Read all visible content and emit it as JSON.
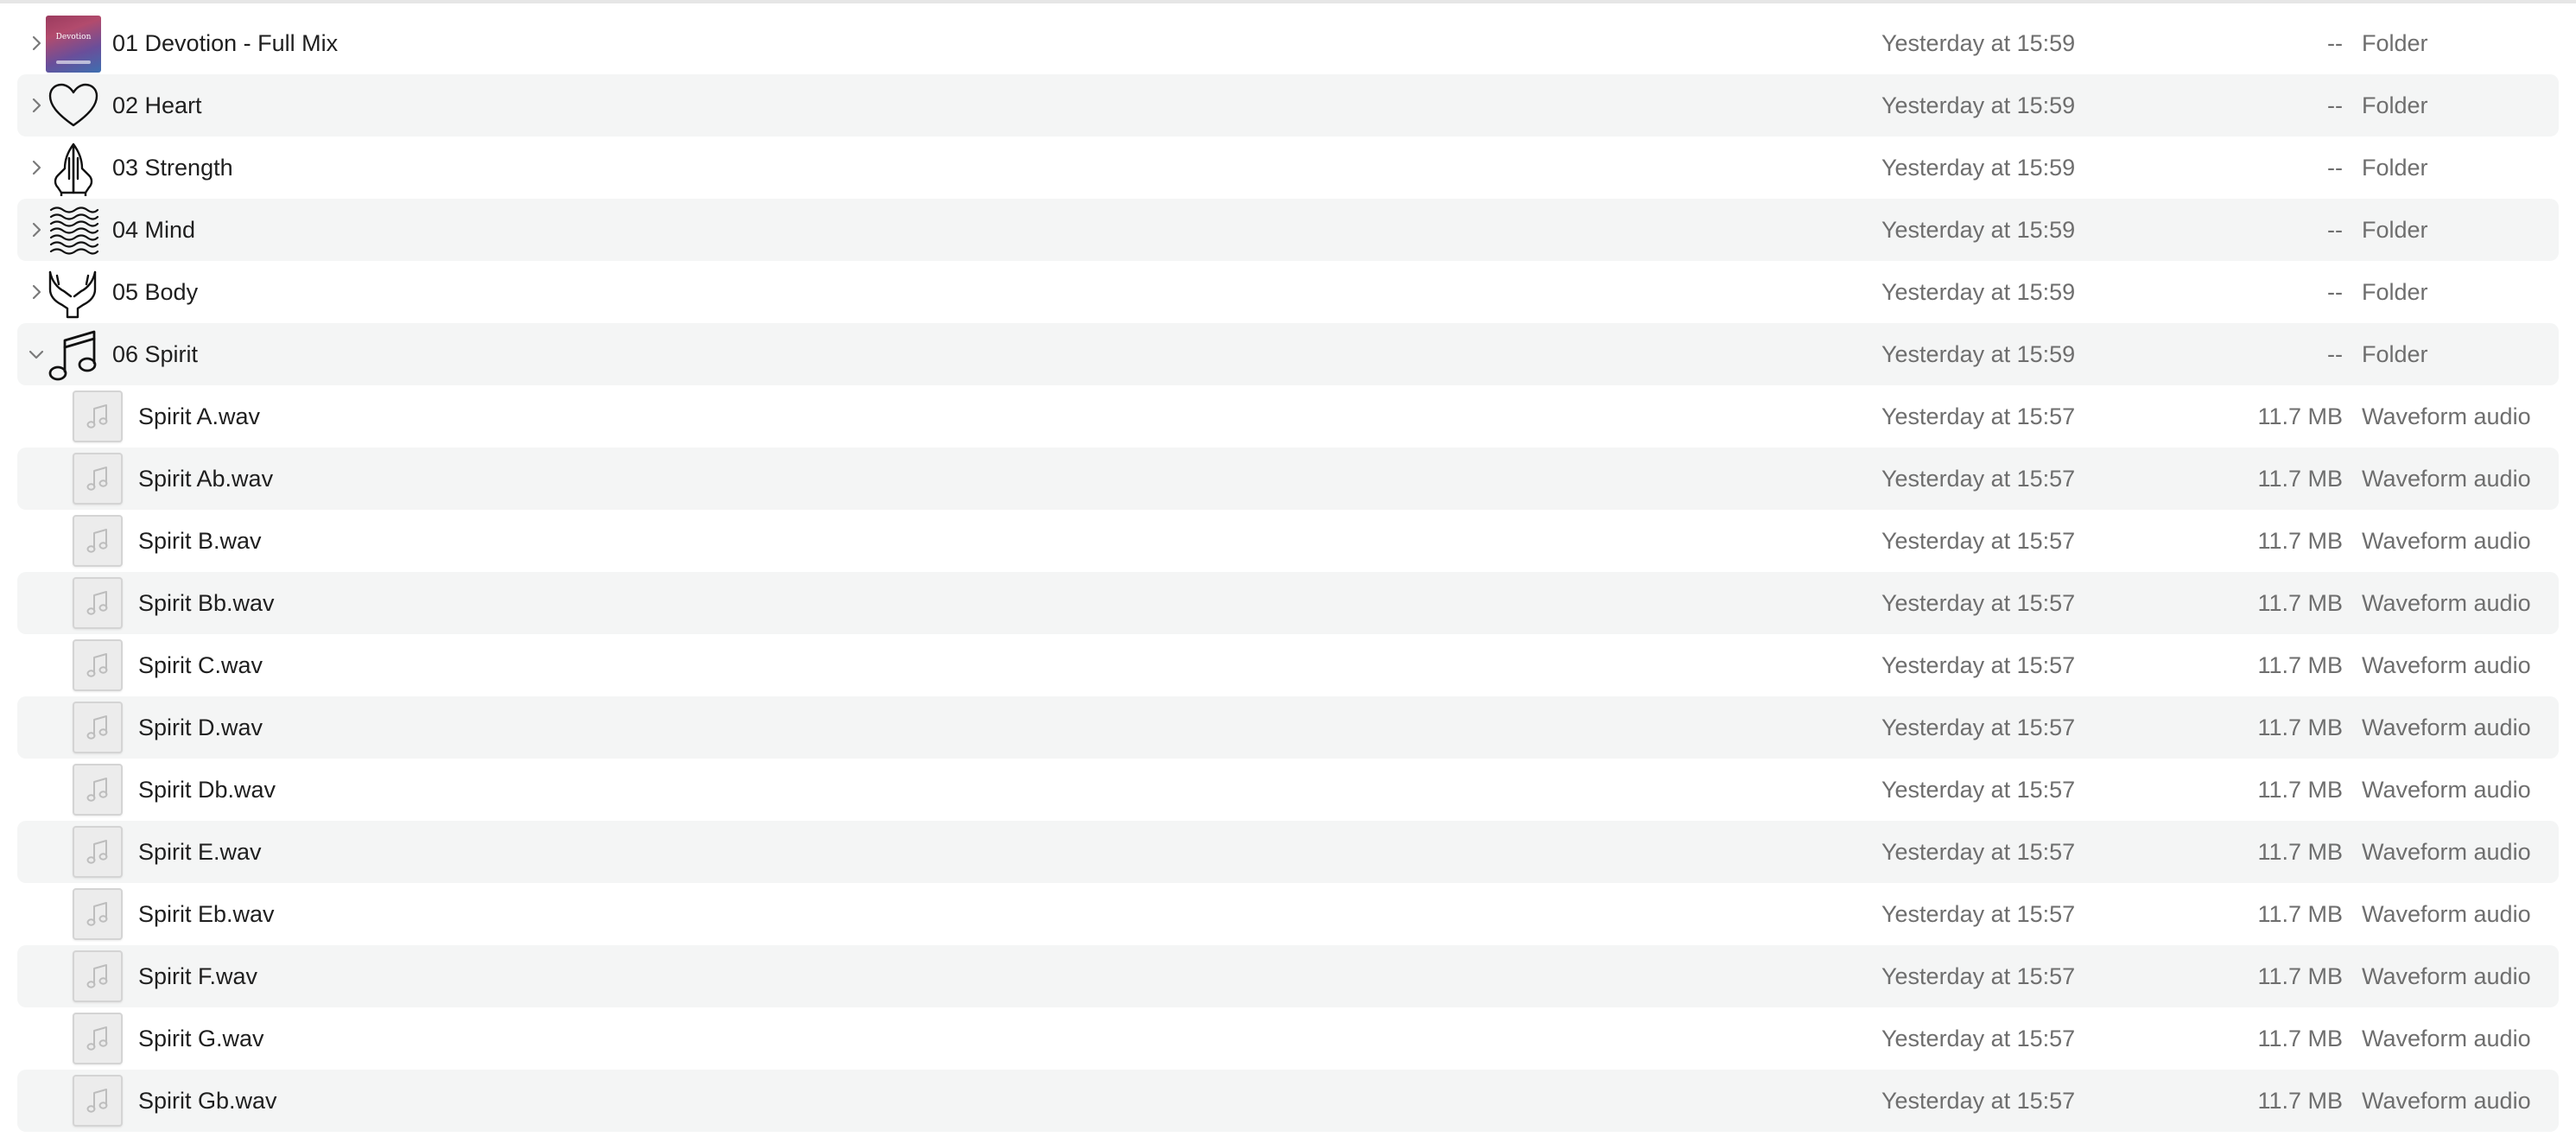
{
  "folders": [
    {
      "name": "01 Devotion - Full Mix",
      "date": "Yesterday at 15:59",
      "size": "--",
      "kind": "Folder",
      "icon": "album-cover-icon",
      "cover_title": "Devotion"
    },
    {
      "name": "02 Heart",
      "date": "Yesterday at 15:59",
      "size": "--",
      "kind": "Folder",
      "icon": "heart-icon"
    },
    {
      "name": "03 Strength",
      "date": "Yesterday at 15:59",
      "size": "--",
      "kind": "Folder",
      "icon": "praying-hands-icon"
    },
    {
      "name": "04 Mind",
      "date": "Yesterday at 15:59",
      "size": "--",
      "kind": "Folder",
      "icon": "waves-icon"
    },
    {
      "name": "05 Body",
      "date": "Yesterday at 15:59",
      "size": "--",
      "kind": "Folder",
      "icon": "open-hands-icon"
    },
    {
      "name": "06 Spirit",
      "date": "Yesterday at 15:59",
      "size": "--",
      "kind": "Folder",
      "icon": "music-note-icon",
      "expanded": true
    }
  ],
  "files": [
    {
      "name": "Spirit A.wav",
      "date": "Yesterday at 15:57",
      "size": "11.7 MB",
      "kind": "Waveform audio"
    },
    {
      "name": "Spirit Ab.wav",
      "date": "Yesterday at 15:57",
      "size": "11.7 MB",
      "kind": "Waveform audio"
    },
    {
      "name": "Spirit B.wav",
      "date": "Yesterday at 15:57",
      "size": "11.7 MB",
      "kind": "Waveform audio"
    },
    {
      "name": "Spirit Bb.wav",
      "date": "Yesterday at 15:57",
      "size": "11.7 MB",
      "kind": "Waveform audio"
    },
    {
      "name": "Spirit C.wav",
      "date": "Yesterday at 15:57",
      "size": "11.7 MB",
      "kind": "Waveform audio"
    },
    {
      "name": "Spirit D.wav",
      "date": "Yesterday at 15:57",
      "size": "11.7 MB",
      "kind": "Waveform audio"
    },
    {
      "name": "Spirit Db.wav",
      "date": "Yesterday at 15:57",
      "size": "11.7 MB",
      "kind": "Waveform audio"
    },
    {
      "name": "Spirit E.wav",
      "date": "Yesterday at 15:57",
      "size": "11.7 MB",
      "kind": "Waveform audio"
    },
    {
      "name": "Spirit Eb.wav",
      "date": "Yesterday at 15:57",
      "size": "11.7 MB",
      "kind": "Waveform audio"
    },
    {
      "name": "Spirit F.wav",
      "date": "Yesterday at 15:57",
      "size": "11.7 MB",
      "kind": "Waveform audio"
    },
    {
      "name": "Spirit G.wav",
      "date": "Yesterday at 15:57",
      "size": "11.7 MB",
      "kind": "Waveform audio"
    },
    {
      "name": "Spirit Gb.wav",
      "date": "Yesterday at 15:57",
      "size": "11.7 MB",
      "kind": "Waveform audio"
    }
  ],
  "colors": {
    "row_alt": "#f4f5f5",
    "secondary_text": "#6e6e6e",
    "primary_text": "#1f1f1f"
  }
}
